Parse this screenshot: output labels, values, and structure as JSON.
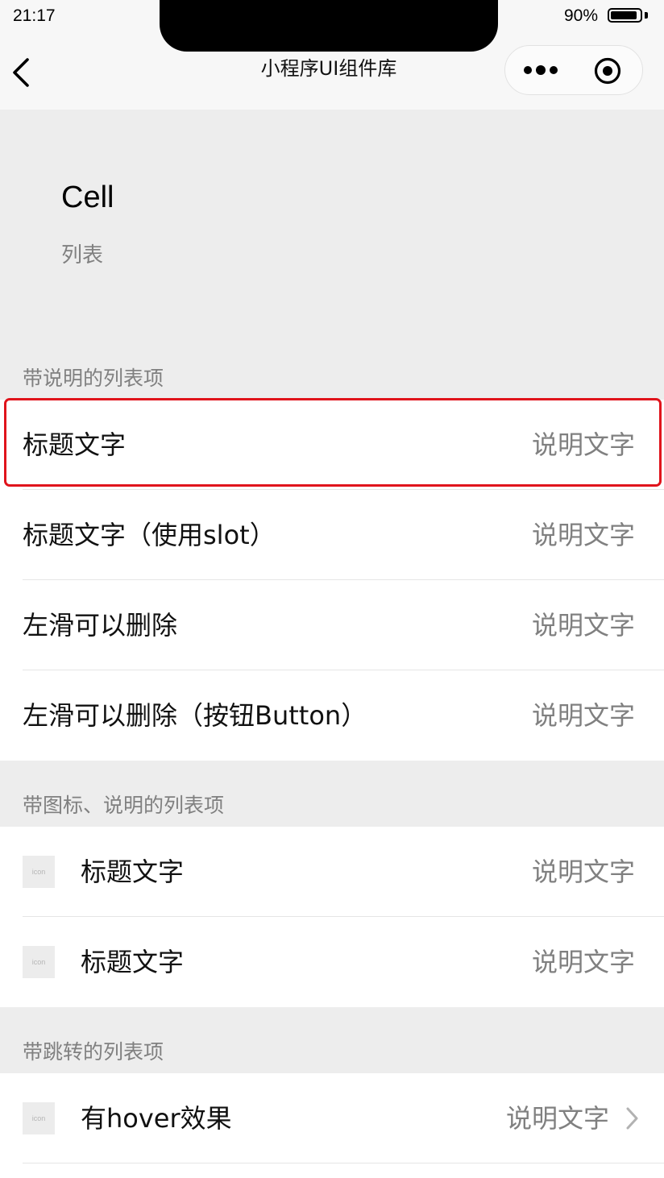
{
  "status_bar": {
    "time": "21:17",
    "battery_percent": "90%",
    "battery_level": 0.9
  },
  "nav_bar": {
    "title": "小程序UI组件库",
    "back_icon": "chevron-left-icon",
    "more_icon": "more-dots-icon",
    "close_icon": "target-circle-icon"
  },
  "page": {
    "title": "Cell",
    "desc": "列表"
  },
  "groups": [
    {
      "title": "带说明的列表项",
      "cells": [
        {
          "title": "标题文字",
          "value": "说明文字"
        },
        {
          "title": "标题文字（使用slot）",
          "value": "说明文字"
        },
        {
          "title": "左滑可以删除",
          "value": "说明文字"
        },
        {
          "title": "左滑可以删除（按钮Button）",
          "value": "说明文字"
        }
      ]
    },
    {
      "title": "带图标、说明的列表项",
      "cells": [
        {
          "icon_text": "icon",
          "title": "标题文字",
          "value": "说明文字"
        },
        {
          "icon_text": "icon",
          "title": "标题文字",
          "value": "说明文字"
        }
      ]
    },
    {
      "title": "带跳转的列表项",
      "cells": [
        {
          "icon_text": "icon",
          "title": "有hover效果",
          "value": "说明文字",
          "arrow_icon": "chevron-right-icon"
        }
      ]
    }
  ],
  "colors": {
    "highlight_border": "#e0141c",
    "page_background": "#ededed",
    "secondary_text": "#808080"
  }
}
